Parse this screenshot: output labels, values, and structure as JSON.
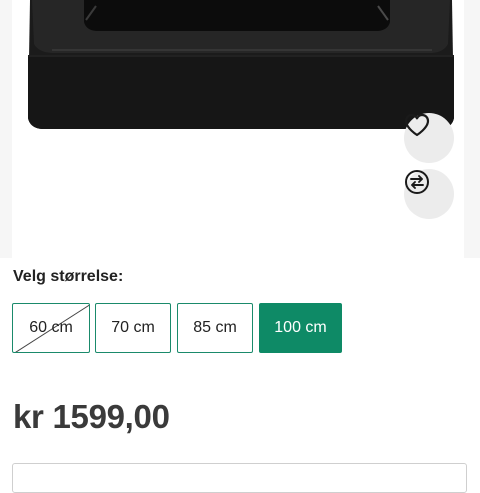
{
  "product": {
    "image_alt": "black square dog bed",
    "favorite_icon": "heart-outline",
    "compare_icon": "compare-arrows"
  },
  "size_selector": {
    "label": "Velg størrelse:",
    "options": [
      {
        "label": "60 cm",
        "available": false,
        "selected": false
      },
      {
        "label": "70 cm",
        "available": true,
        "selected": false
      },
      {
        "label": "85 cm",
        "available": true,
        "selected": false
      },
      {
        "label": "100 cm",
        "available": true,
        "selected": true
      }
    ]
  },
  "price": "kr 1599,00",
  "colors": {
    "accent": "#0e8a66",
    "border": "#1a8a6b"
  }
}
